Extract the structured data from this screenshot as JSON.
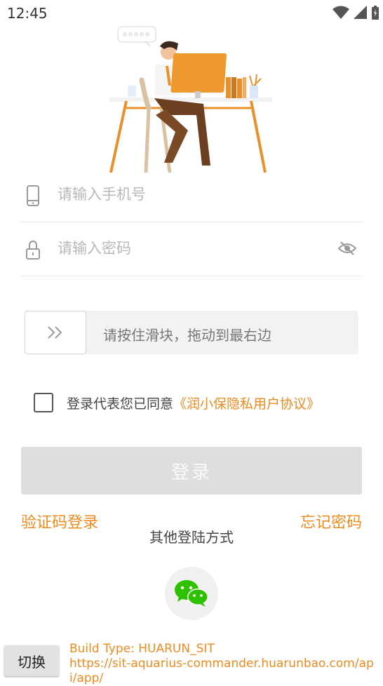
{
  "status_bar": {
    "time": "12:45",
    "icons": [
      "wifi-icon",
      "cell-signal-icon",
      "battery-icon"
    ]
  },
  "login_form": {
    "phone_placeholder": "请输入手机号",
    "password_placeholder": "请输入密码"
  },
  "slider_captcha": {
    "hint": "请按住滑块，拖动到最右边"
  },
  "agreement": {
    "text": "登录代表您已同意",
    "link": "《润小保隐私用户协议》",
    "checked": false
  },
  "actions": {
    "login_label": "登录",
    "code_login_label": "验证码登录",
    "forgot_password_label": "忘记密码",
    "other_methods_label": "其他登陆方式"
  },
  "debug": {
    "switch_label": "切换",
    "build_type_line": "Build Type:  HUARUN_SIT",
    "url_line": "https://sit-aquarius-commander.huarunbao.com/api/app/"
  },
  "colors": {
    "accent": "#f08a1e",
    "wechat_green": "#2dc100",
    "disabled_button": "#dedede"
  }
}
